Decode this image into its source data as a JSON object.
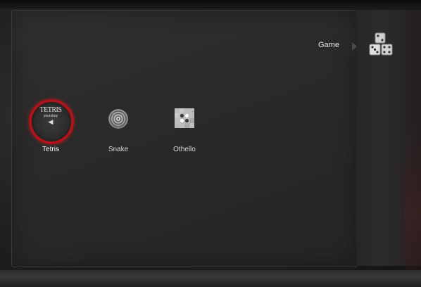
{
  "header": {
    "section_title": "Game"
  },
  "category": {
    "icon": "dice-icon"
  },
  "games": [
    {
      "label": "Tetris",
      "icon": "tetris-logo-icon",
      "selected": true
    },
    {
      "label": "Snake",
      "icon": "spiral-icon",
      "selected": false
    },
    {
      "label": "Othello",
      "icon": "checker-board-icon",
      "selected": false
    }
  ],
  "tetris_logo": {
    "line1": "TETRIS",
    "line2": "yoursboy"
  },
  "colors": {
    "selection_ring": "#b0121a",
    "background": "#2a2a2a",
    "text": "#e6e6e6"
  }
}
